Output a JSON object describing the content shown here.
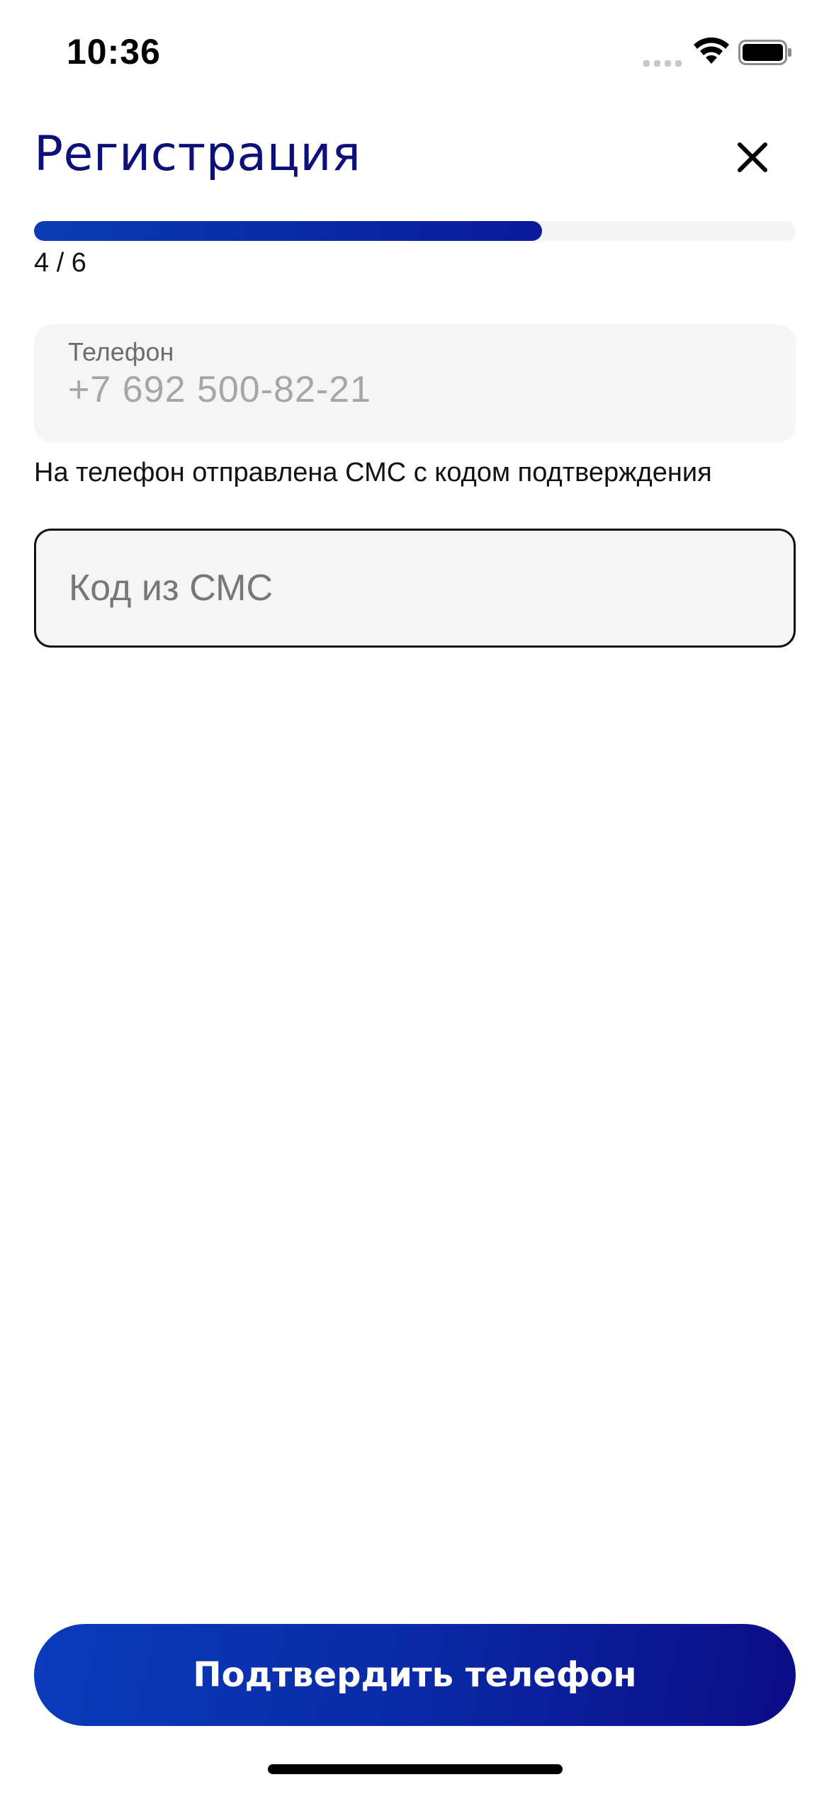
{
  "status_bar": {
    "time": "10:36",
    "icons": [
      "signal-icon",
      "wifi-icon",
      "battery-icon"
    ]
  },
  "header": {
    "title": "Регистрация",
    "close_icon": "close-icon"
  },
  "progress": {
    "label": "4 / 6",
    "current_step": 4,
    "total_steps": 6,
    "fraction": 0.667
  },
  "phone_field": {
    "label": "Телефон",
    "value": "+7 692 500-82-21"
  },
  "hint": "На телефон отправлена СМС с кодом подтверждения",
  "code_field": {
    "placeholder": "Код из СМС",
    "value": ""
  },
  "confirm_button": {
    "label": "Подтвердить телефон"
  },
  "colors": {
    "title": "#0d0f7a",
    "accent_start": "#0a3cbc",
    "accent_end": "#0c0c86",
    "field_bg": "#f5f5f5"
  }
}
